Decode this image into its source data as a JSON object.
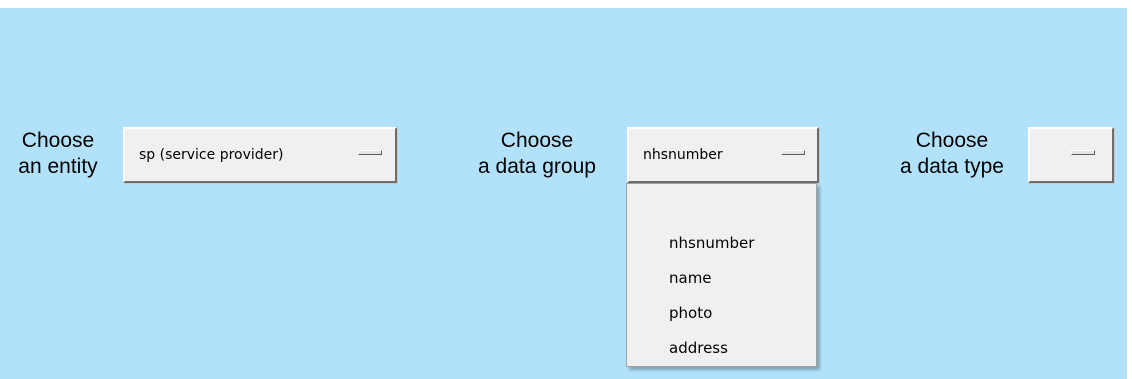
{
  "entity": {
    "label_line1": "Choose",
    "label_line2": "an entity",
    "selected": "sp (service provider)"
  },
  "data_group": {
    "label_line1": "Choose",
    "label_line2": "a data group",
    "selected": "nhsnumber",
    "options": [
      "nhsnumber",
      "name",
      "photo",
      "address"
    ]
  },
  "data_type": {
    "label_line1": "Choose",
    "label_line2": "a data type",
    "selected": ""
  },
  "colors": {
    "background": "#b2e2fb",
    "button_face": "#f0f0f0",
    "menu_face": "#f0f0f0"
  }
}
